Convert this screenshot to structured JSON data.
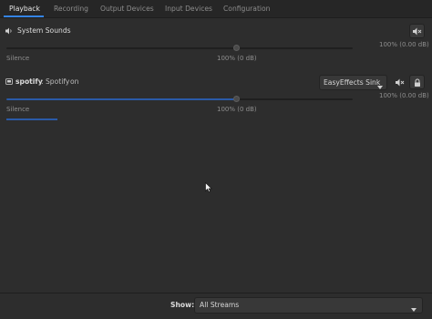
{
  "tabs": [
    {
      "label": "Playback",
      "active": true
    },
    {
      "label": "Recording",
      "active": false
    },
    {
      "label": "Output Devices",
      "active": false
    },
    {
      "label": "Input Devices",
      "active": false
    },
    {
      "label": "Configuration",
      "active": false
    }
  ],
  "system_sounds": {
    "icon": "speaker-icon",
    "label": "System Sounds",
    "volume_percent": 100,
    "scale_left": "Silence",
    "scale_mid": "100% (0 dB)",
    "scale_right": "100% (0.00 dB)"
  },
  "spotify": {
    "app_name": "spotify",
    "stream_label": ": Spotify",
    "status": "on",
    "sink": "EasyEffects Sink",
    "volume_percent": 100,
    "peak_fraction": 0.12,
    "scale_left": "Silence",
    "scale_mid": "100% (0 dB)",
    "scale_right": "100% (0.00 dB)"
  },
  "footer": {
    "show_label": "Show:",
    "show_value": "All Streams"
  },
  "colors": {
    "accent": "#3584e4",
    "background": "#2d2d2d"
  }
}
